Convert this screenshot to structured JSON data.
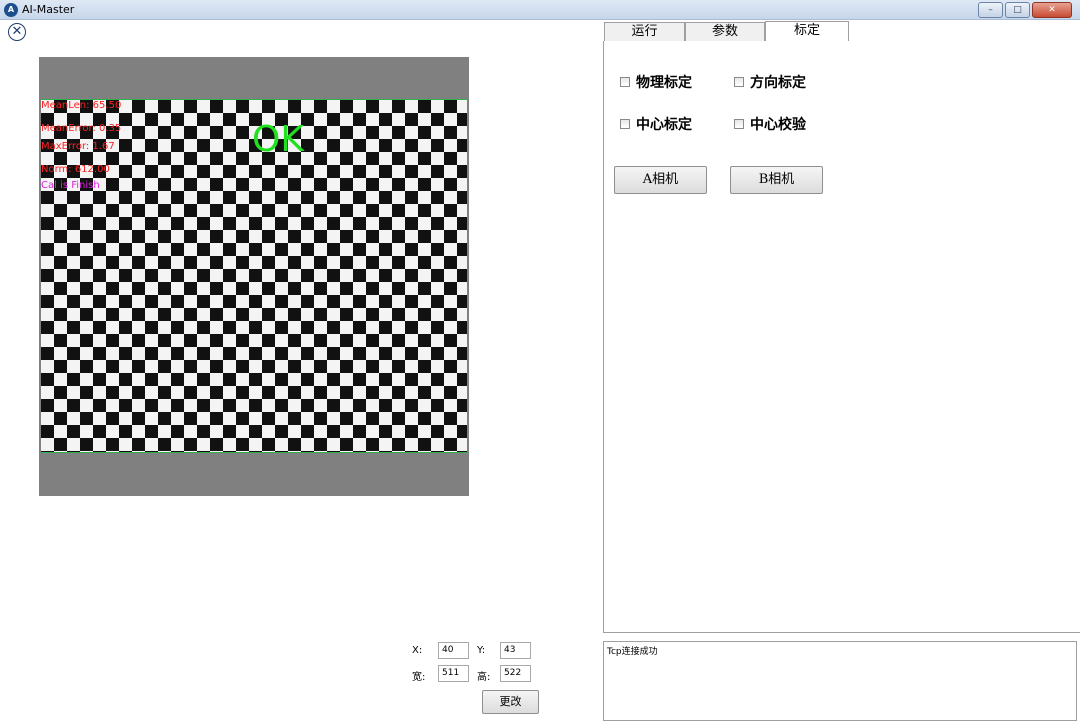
{
  "window": {
    "title": "AI-Master",
    "controls": [
      "minimize",
      "maximize",
      "close"
    ]
  },
  "image_view": {
    "overlay_lines": [
      {
        "text": "MeanLen: 65.50",
        "color": "#ff2020"
      },
      {
        "text": "MeanError: 0.35",
        "color": "#ff2020"
      },
      {
        "text": "MaxError: 1.67",
        "color": "#ff2020"
      },
      {
        "text": "Norm: 612.00",
        "color": "#ff2020"
      },
      {
        "text": "Cal is Finish",
        "color": "#e020e0"
      }
    ],
    "status": "OK"
  },
  "tabs": [
    {
      "label": "运行",
      "active": false
    },
    {
      "label": "参数",
      "active": false
    },
    {
      "label": "标定",
      "active": true
    }
  ],
  "calibration": {
    "checkboxes": {
      "physical": {
        "label": "物理标定",
        "checked": false
      },
      "direction": {
        "label": "方向标定",
        "checked": false
      },
      "center": {
        "label": "中心标定",
        "checked": false
      },
      "center_verify": {
        "label": "中心校验",
        "checked": false
      }
    },
    "camera_a": "A相机",
    "camera_b": "B相机"
  },
  "log": {
    "text": "Tcp连接成功"
  },
  "roi": {
    "x_label": "X:",
    "x_value": "40",
    "y_label": "Y:",
    "y_value": "43",
    "w_label": "宽:",
    "w_value": "511",
    "h_label": "高:",
    "h_value": "522",
    "change_label": "更改"
  }
}
